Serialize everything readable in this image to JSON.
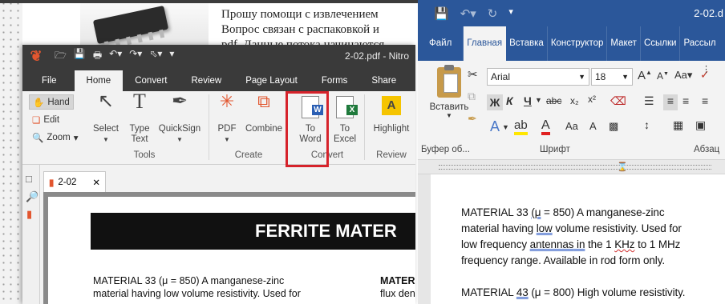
{
  "forum": {
    "line1": "Прошу помощи с извлечением",
    "line2": "Вопрос связан с распаковкой и",
    "line3": "pdf. Данные потока начинаются"
  },
  "nitro": {
    "window_title": "2-02.pdf - Nitro",
    "tabs": [
      "File",
      "Home",
      "Convert",
      "Review",
      "Page Layout",
      "Forms",
      "Share"
    ],
    "side_tools": {
      "hand": "Hand",
      "edit": "Edit",
      "zoom": "Zoom"
    },
    "ribbon": {
      "select": "Select",
      "type_text": "Type\nText",
      "quicksign": "QuickSign",
      "tools_group": "Tools",
      "pdf": "PDF",
      "combine": "Combine",
      "create_group": "Create",
      "to_word": "To\nWord",
      "to_excel": "To\nExcel",
      "convert_group": "Convert",
      "highlight": "Highlight",
      "review_group": "Review"
    },
    "doc_tab": "2-02",
    "doc": {
      "banner": "FERRITE MATER",
      "col1_line1": "MATERIAL 33   (μ = 850)    A manganese-zinc",
      "col1_line2": "material having low volume resistivity.  Used for",
      "col2_line1": "MATERI",
      "col2_line2": "flux den"
    }
  },
  "word": {
    "doc_title": "2-02.d",
    "tabs": [
      "Файл",
      "Главная",
      "Вставка",
      "Конструктор",
      "Макет",
      "Ссылки",
      "Рассыл"
    ],
    "font_name": "Arial",
    "font_size": "18",
    "paste_label": "Вставить",
    "clipboard_group": "Буфер об...",
    "font_group": "Шрифт",
    "paragraph_group": "Абзац",
    "format_buttons": {
      "bold": "Ж",
      "italic": "К",
      "underline": "Ч",
      "strike": "abc",
      "sub": "x₂",
      "sup": "x²"
    },
    "body": {
      "l1_a": "MATERIAL 33 ",
      "l1_mu": "(μ",
      "l1_b": " = 850)    A manganese-zinc",
      "l2_a": "material having ",
      "l2_low": "low",
      "l2_b": " volume resistivity.  Used for",
      "l3_a": "low frequency ",
      "l3_ant": "antennas",
      "l3_in": " in",
      "l3_b": " the 1 ",
      "l3_khz": "KHz",
      "l3_c": " to 1 MHz",
      "l4": "frequency range. Available in rod form only.",
      "l5_a": "MATERIAL ",
      "l5_43": "43",
      "l5_b": "  (μ = 800)    High volume  resistivity."
    }
  },
  "colors": {
    "nitro_dark": "#3a3a3a",
    "nitro_accent": "#e2562f",
    "word_blue": "#2b579a",
    "highlight_red": "#d6232b"
  }
}
